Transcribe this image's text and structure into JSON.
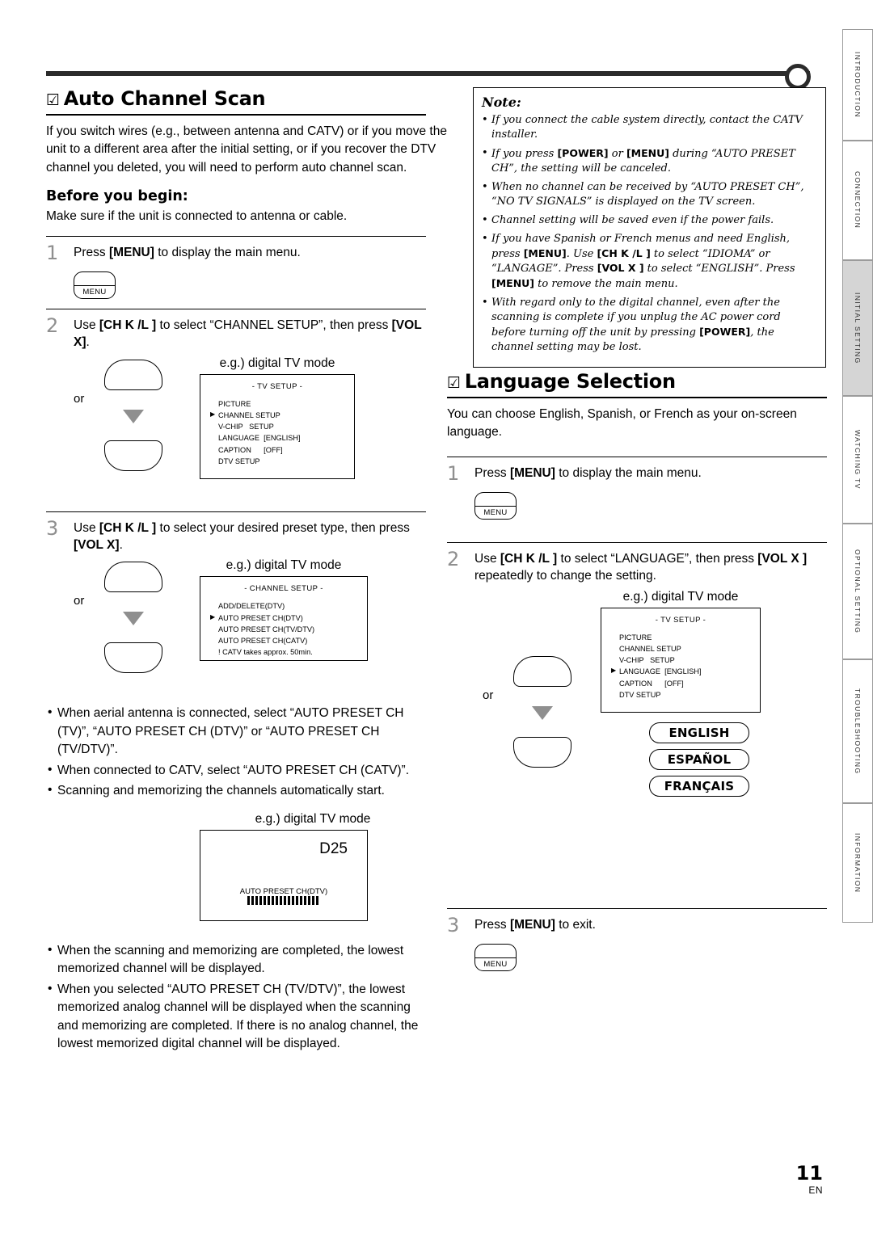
{
  "page": {
    "number": "11",
    "lang_code": "EN"
  },
  "top_rule": {
    "icon": "rule-with-circle"
  },
  "side_tabs": [
    {
      "label": "INTRODUCTION",
      "active": false
    },
    {
      "label": "CONNECTION",
      "active": false
    },
    {
      "label": "INITIAL SETTING",
      "active": true
    },
    {
      "label": "WATCHING TV",
      "active": false
    },
    {
      "label": "OPTIONAL SETTING",
      "active": false
    },
    {
      "label": "TROUBLESHOOTING",
      "active": false
    },
    {
      "label": "INFORMATION",
      "active": false
    }
  ],
  "auto_scan": {
    "bullet": "☑",
    "title": "Auto Channel Scan",
    "intro": "If you switch wires (e.g., between antenna and CATV) or if you move the unit to a different area after the initial setting, or if you recover the DTV channel you deleted, you will need to perform auto channel scan.",
    "before_head": "Before you begin:",
    "before_text": "Make sure if the unit is connected to antenna or cable.",
    "steps": [
      {
        "num": "1",
        "text": "Press [MENU] to display the main menu.",
        "button": "MENU"
      },
      {
        "num": "2",
        "text": "Use [CH Κ /L ] to select “CHANNEL SETUP”, then press [VOL X]."
      },
      {
        "num": "3",
        "text": "Use [CH Κ /L ] to select your desired preset type, then press [VOL X]."
      }
    ],
    "eg_label": "e.g.) digital TV mode",
    "or_label": "or",
    "osd_tv_setup": {
      "title": "- TV SETUP -",
      "rows": [
        {
          "text": "PICTURE",
          "arrow": false
        },
        {
          "text": "CHANNEL SETUP",
          "arrow": true
        },
        {
          "text": "V-CHIP   SETUP",
          "arrow": false
        },
        {
          "text": "LANGUAGE  [ENGLISH]",
          "arrow": false
        },
        {
          "text": "CAPTION      [OFF]",
          "arrow": false
        },
        {
          "text": "DTV SETUP",
          "arrow": false
        }
      ]
    },
    "osd_channel_setup": {
      "title": "- CHANNEL SETUP -",
      "rows": [
        {
          "text": "ADD/DELETE(DTV)",
          "arrow": false
        },
        {
          "text": "AUTO PRESET CH(DTV)",
          "arrow": true
        },
        {
          "text": "AUTO PRESET CH(TV/DTV)",
          "arrow": false
        },
        {
          "text": "AUTO PRESET CH(CATV)",
          "arrow": false
        },
        {
          "text": "! CATV takes approx. 50min.",
          "arrow": false
        }
      ]
    },
    "bullets_mid": [
      "When aerial antenna is connected, select “AUTO PRESET CH (TV)”, “AUTO PRESET CH (DTV)” or “AUTO PRESET CH (TV/DTV)”.",
      "When connected to CATV, select “AUTO PRESET CH (CATV)”.",
      "Scanning and memorizing the channels automatically start."
    ],
    "scan_screen": {
      "channel": "D25",
      "label": "AUTO PRESET CH(DTV)",
      "progress_segments": 18
    },
    "bullets_end": [
      "When the scanning and memorizing are completed, the lowest memorized channel will be displayed.",
      "When you selected “AUTO PRESET CH (TV/DTV)”, the lowest memorized analog channel will be displayed when the scanning and memorizing are completed. If there is no analog channel, the lowest memorized digital channel will be displayed."
    ]
  },
  "note": {
    "heading": "Note:",
    "items": [
      "If you connect the cable system directly, contact the CATV installer.",
      "If you press [POWER] or [MENU] during “AUTO PRESET CH”, the setting will be canceled.",
      "When no channel can be received by “AUTO PRESET CH”, “NO TV SIGNALS” is displayed on the TV screen.",
      "Channel setting will be saved even if the power fails.",
      "If you have Spanish or French menus and need English, press [MENU]. Use [CH Κ /L ] to select “IDIOMA” or “LANGAGE”. Press [VOL X ] to select “ENGLISH”. Press [MENU] to remove the main menu.",
      "With regard only to the digital channel, even after the scanning is complete if you unplug the AC power cord before turning off the unit by pressing [POWER], the channel setting may be lost."
    ]
  },
  "language": {
    "bullet": "☑",
    "title": "Language Selection",
    "intro": "You can choose English, Spanish, or French as your on-screen language.",
    "steps": [
      {
        "num": "1",
        "text": "Press [MENU] to display the main menu.",
        "button": "MENU"
      },
      {
        "num": "2",
        "text": "Use [CH Κ /L ] to select “LANGUAGE”, then press [VOL X ] repeatedly to change the setting."
      },
      {
        "num": "3",
        "text": "Press [MENU] to exit.",
        "button": "MENU"
      }
    ],
    "eg_label": "e.g.) digital TV mode",
    "or_label": "or",
    "osd_tv_setup": {
      "title": "- TV SETUP -",
      "rows": [
        {
          "text": "PICTURE",
          "arrow": false
        },
        {
          "text": "CHANNEL SETUP",
          "arrow": false
        },
        {
          "text": "V-CHIP   SETUP",
          "arrow": false
        },
        {
          "text": "LANGUAGE  [ENGLISH]",
          "arrow": true
        },
        {
          "text": "CAPTION      [OFF]",
          "arrow": false
        },
        {
          "text": "DTV SETUP",
          "arrow": false
        }
      ]
    },
    "pills": [
      "ENGLISH",
      "ESPAÑOL",
      "FRANÇAIS"
    ]
  }
}
